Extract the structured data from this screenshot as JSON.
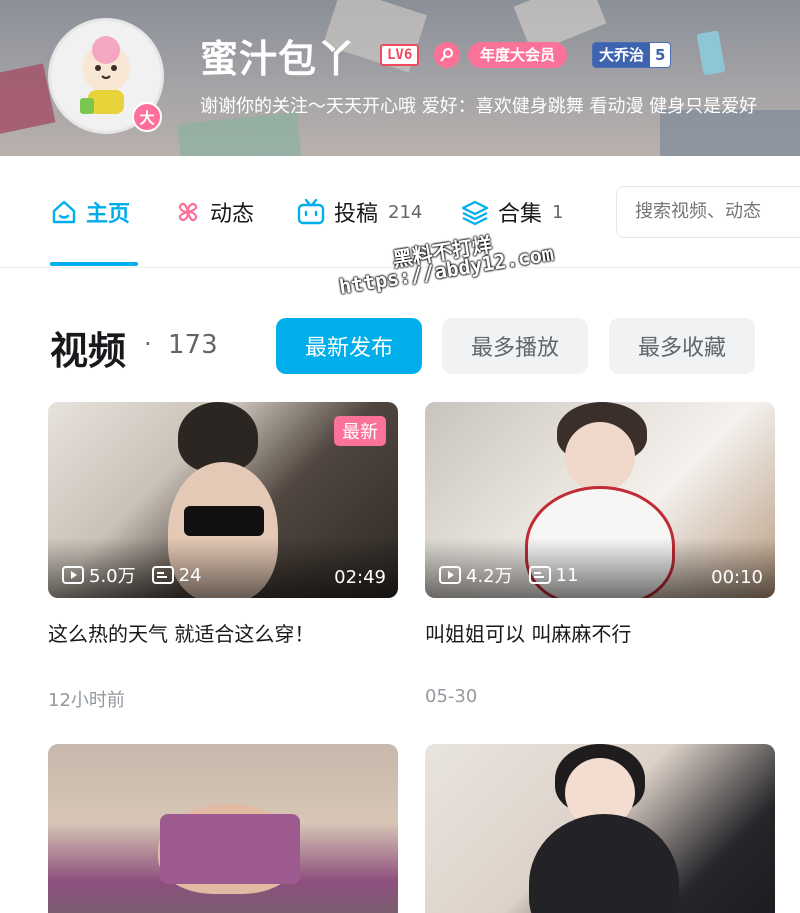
{
  "profile": {
    "username": "蜜汁包丫",
    "level": "LV6",
    "vip_label": "年度大会员",
    "avatar_badge": "大",
    "fan_badge_name": "大乔治",
    "fan_badge_level": "5",
    "signature": "谢谢你的关注～天天开心哦 爱好：喜欢健身跳舞 看动漫 健身只是爱好"
  },
  "tabs": [
    {
      "label": "主页",
      "count": ""
    },
    {
      "label": "动态",
      "count": ""
    },
    {
      "label": "投稿",
      "count": "214"
    },
    {
      "label": "合集",
      "count": "1"
    }
  ],
  "search": {
    "placeholder": "搜索视频、动态"
  },
  "watermark": {
    "line1": "黑料不打烊",
    "line2": "https://abdy12.com"
  },
  "section": {
    "title": "视频",
    "separator": "·",
    "count": "173",
    "sort": [
      "最新发布",
      "最多播放",
      "最多收藏"
    ]
  },
  "videos": [
    {
      "plays": "5.0万",
      "comments": "24",
      "duration": "02:49",
      "tag": "最新",
      "title": "这么热的天气 就适合这么穿！",
      "date": "12小时前"
    },
    {
      "plays": "4.2万",
      "comments": "11",
      "duration": "00:10",
      "tag": "",
      "title": "叫姐姐可以 叫麻麻不行",
      "date": "05-30"
    },
    {
      "plays": "",
      "comments": "",
      "duration": "",
      "tag": "",
      "title": "",
      "date": ""
    },
    {
      "plays": "",
      "comments": "",
      "duration": "",
      "tag": "",
      "title": "",
      "date": ""
    }
  ],
  "colors": {
    "accent": "#00aeec",
    "pink": "#fb7299",
    "level": "#f04a5d",
    "fan_badge": "#3e64b0"
  }
}
